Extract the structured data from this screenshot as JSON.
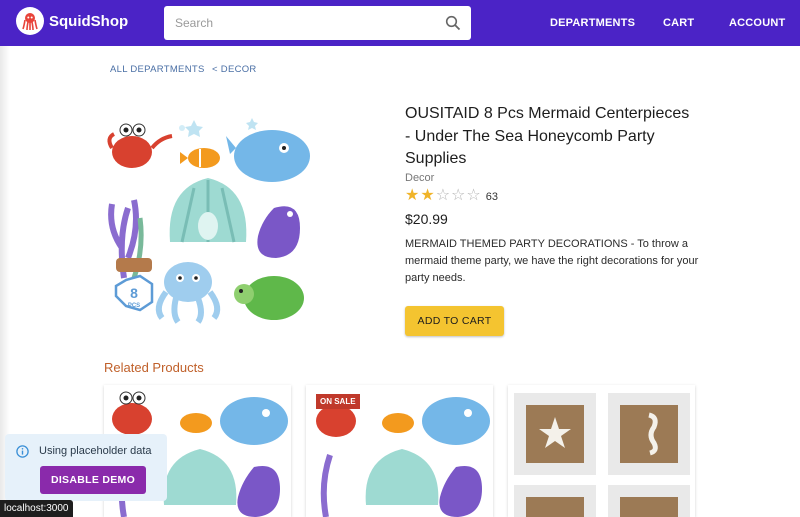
{
  "header": {
    "brand": "SquidShop",
    "search_placeholder": "Search",
    "nav": [
      "DEPARTMENTS",
      "CART",
      "ACCOUNT"
    ],
    "colors": {
      "bar": "#4b23c6"
    }
  },
  "breadcrumb": {
    "all": "ALL DEPARTMENTS",
    "current": "< DECOR"
  },
  "product": {
    "title": "OUSITAID 8 Pcs Mermaid Centerpieces - Under The Sea Honeycomb Party Supplies",
    "category": "Decor",
    "rating": 2,
    "rating_max": 5,
    "review_count": "63",
    "price": "$20.99",
    "description": "MERMAID THEMED PARTY DECORATIONS - To throw a mermaid theme party, we have the right decorations for your party needs.",
    "add_to_cart": "ADD TO CART",
    "image_badge": "8",
    "image_badge_sub": "PCS"
  },
  "related": {
    "title": "Related Products",
    "cards": [
      {
        "badge": ""
      },
      {
        "badge": "ON SALE"
      },
      {
        "badge": ""
      }
    ]
  },
  "toast": {
    "message": "Using placeholder data",
    "button": "DISABLE DEMO"
  },
  "status_bar": "localhost:3000"
}
